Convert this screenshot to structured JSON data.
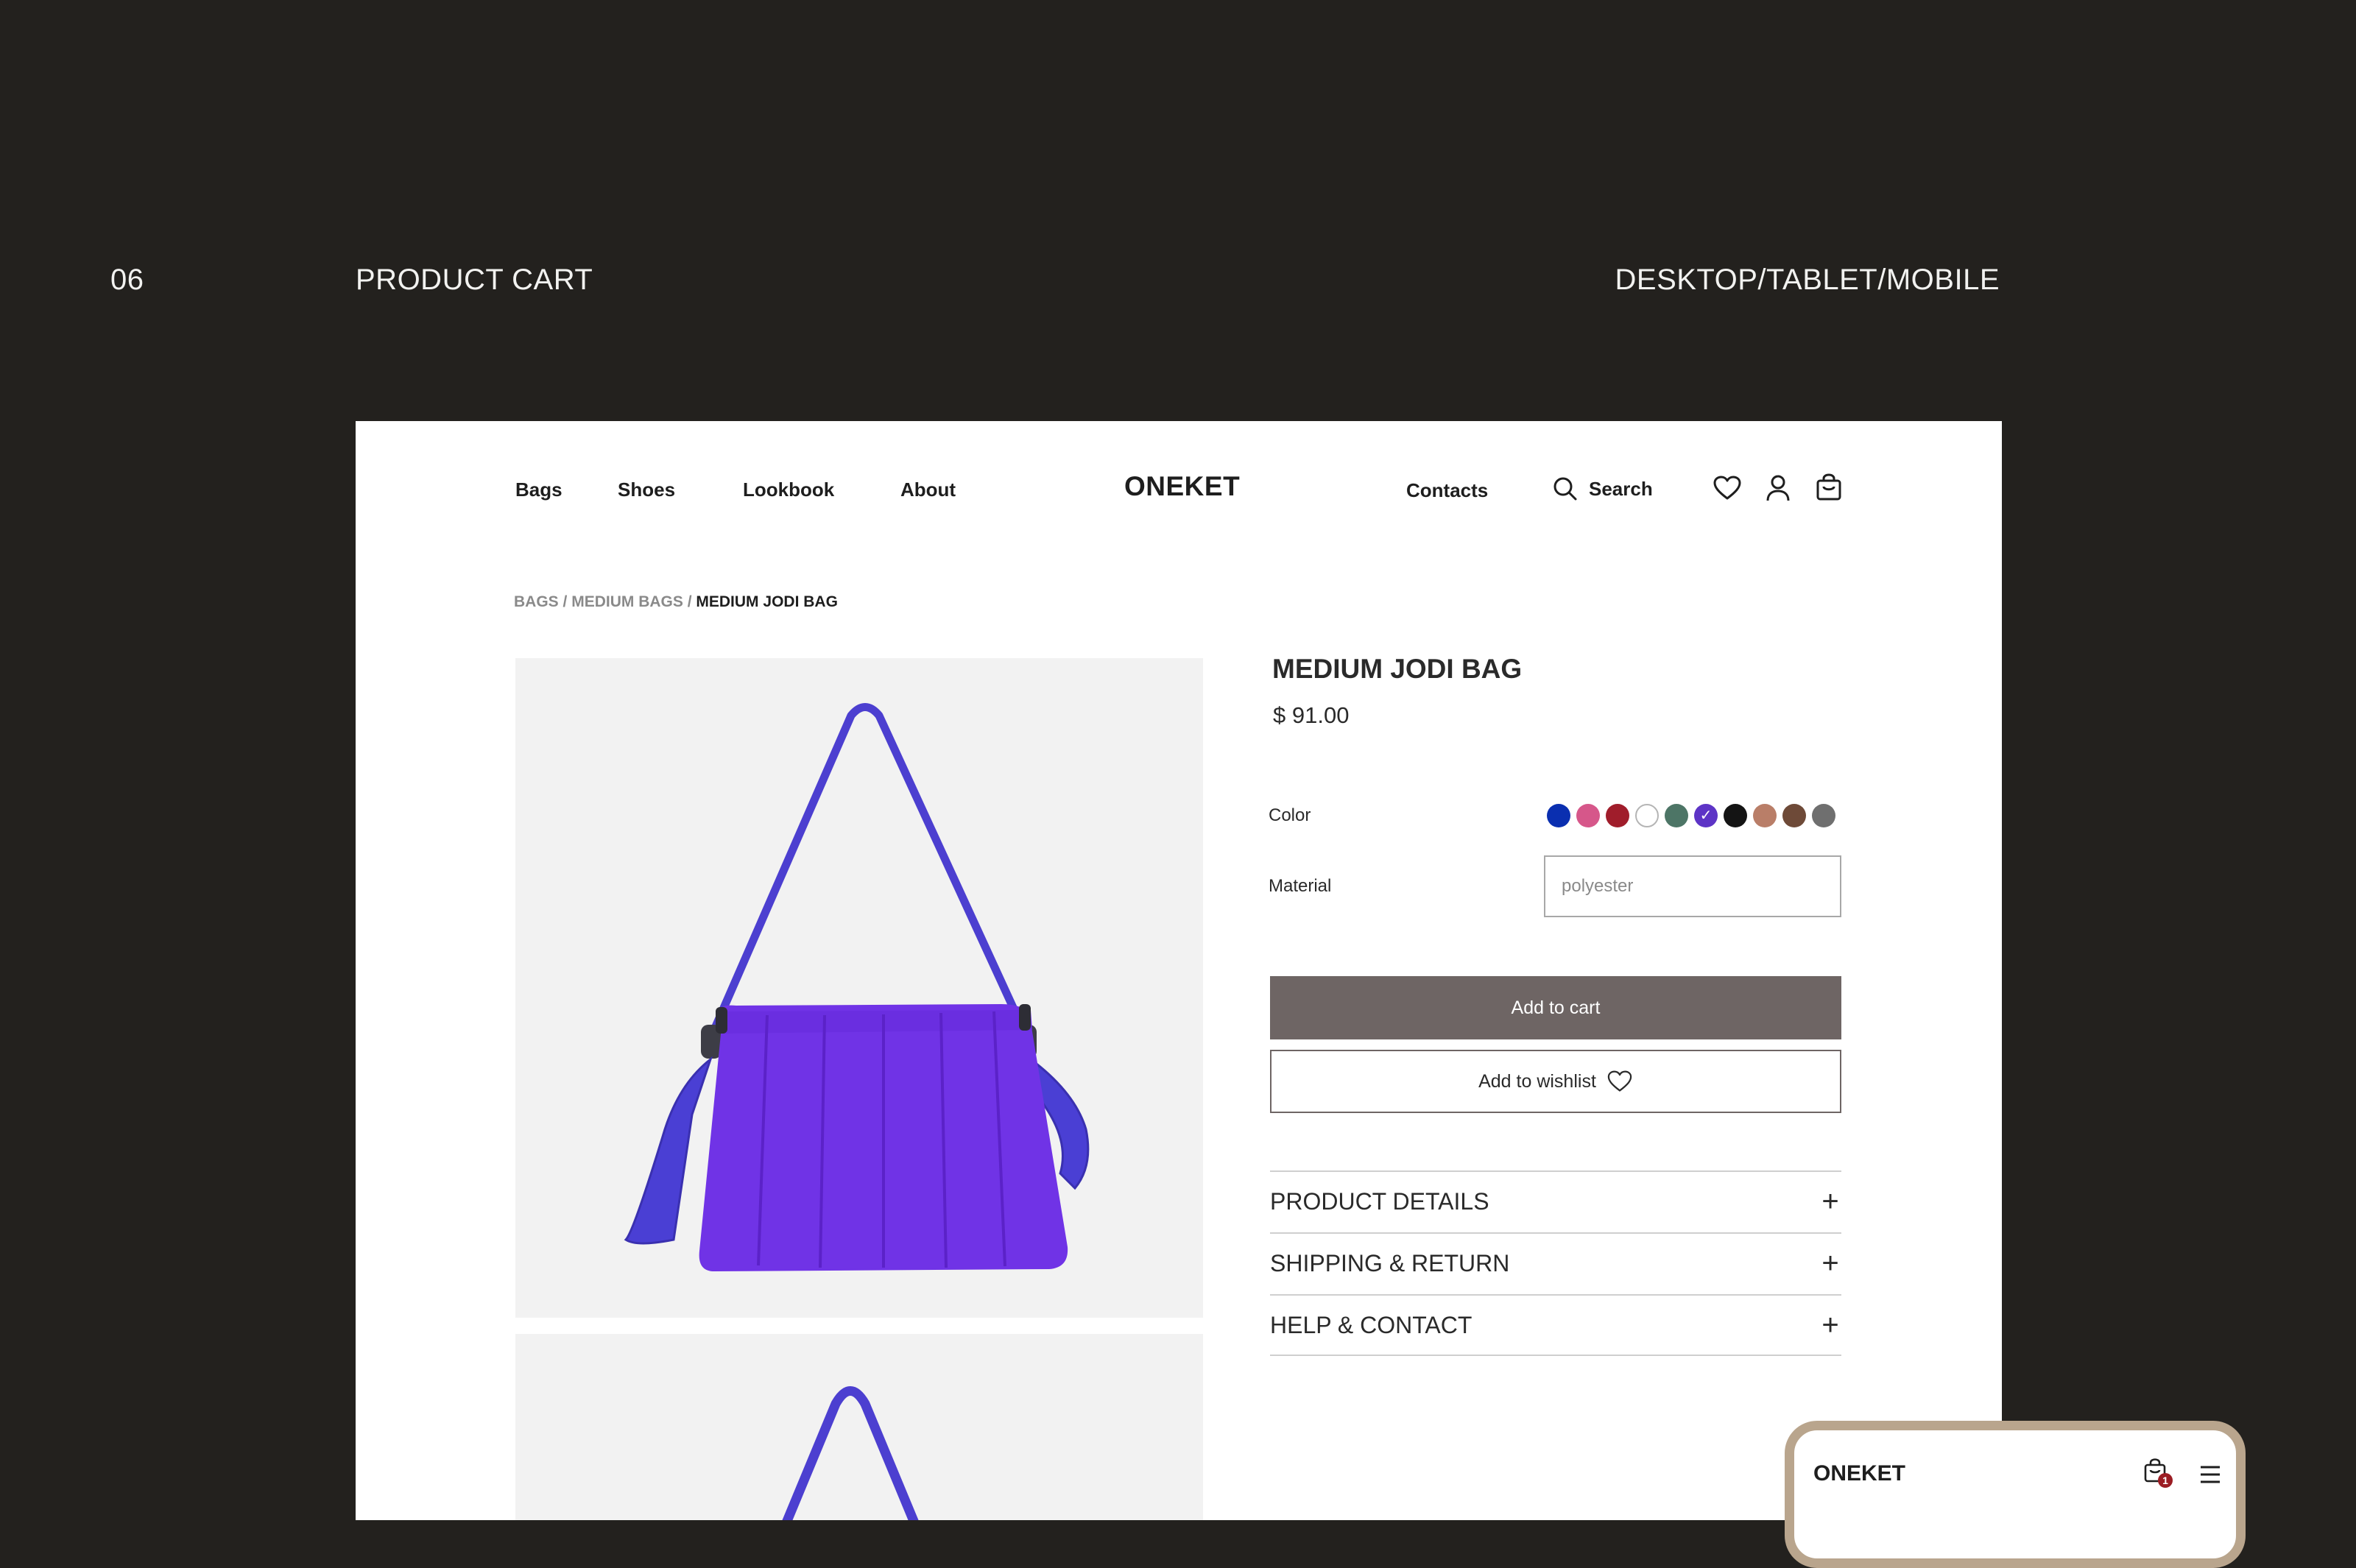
{
  "section": {
    "number": "06",
    "title": "PRODUCT CART",
    "devices": "DESKTOP/TABLET/MOBILE"
  },
  "nav": {
    "links": [
      "Bags",
      "Shoes",
      "Lookbook",
      "About"
    ],
    "logo": "ONEKET",
    "contacts": "Contacts",
    "search": "Search",
    "icons": [
      "heart-icon",
      "user-icon",
      "cart-icon",
      "search-icon"
    ]
  },
  "breadcrumb": {
    "parts": [
      "BAGS",
      "MEDIUM BAGS"
    ],
    "separator": " / ",
    "current": "MEDIUM JODI BAG"
  },
  "product": {
    "title": "MEDIUM JODI BAG",
    "price": "$ 91.00",
    "color_label": "Color",
    "colors": [
      "#0a2fb0",
      "#d6578a",
      "#a01d2b",
      "#ffffff",
      "#4d7566",
      "#5d34c6",
      "#141414",
      "#b97e68",
      "#6e4a38",
      "#6f6f6f"
    ],
    "selected_color": "#5d34c6",
    "material_label": "Material",
    "material_value": "polyester",
    "add_to_cart": "Add to cart",
    "add_to_wishlist": "Add to wishlist",
    "accordion": [
      "PRODUCT DETAILS",
      "SHIPPING & RETURN",
      "HELP & CONTACT"
    ]
  },
  "mobile": {
    "logo": "ONEKET",
    "cart_count": "1"
  },
  "colors": {
    "background": "#23211e",
    "primary_button": "#6e6564",
    "bag_purple": "#7033e6",
    "mobile_frame": "#b9a58d",
    "badge": "#9b1c23"
  }
}
